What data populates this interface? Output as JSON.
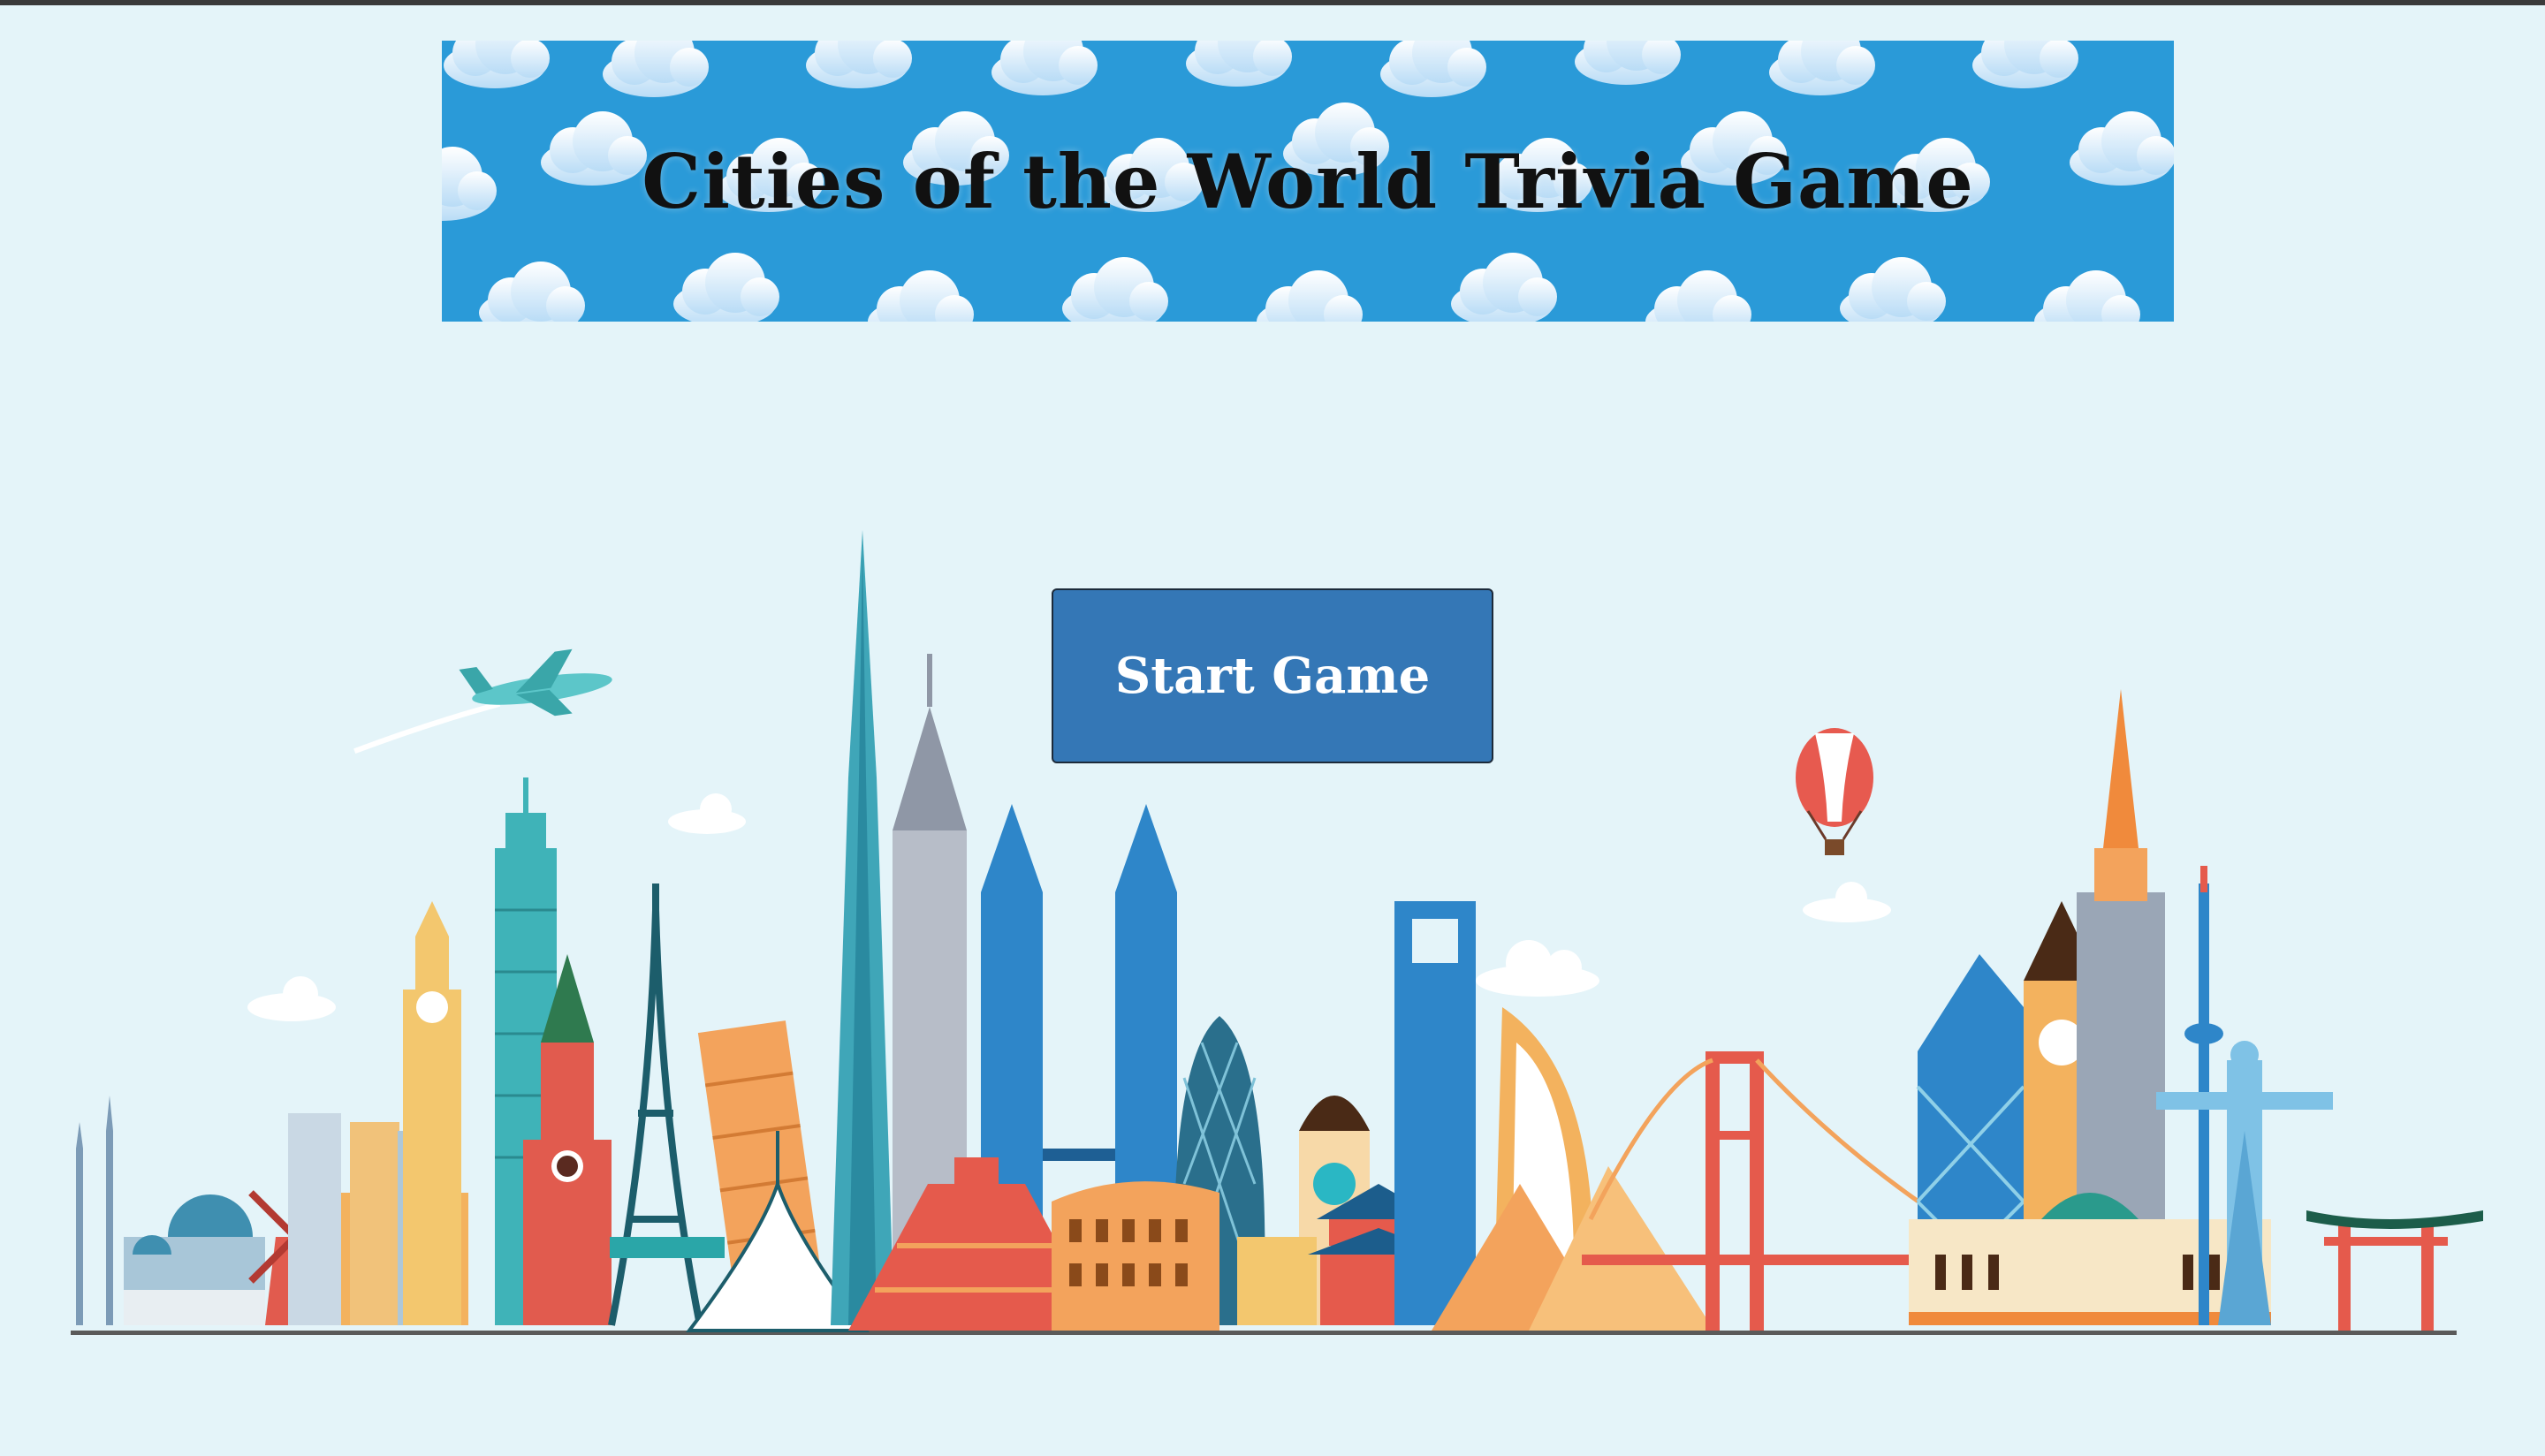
{
  "app": {
    "title": "Cities of the World Trivia Game"
  },
  "banner": {
    "title": "Cities of the World Trivia Game",
    "background_color": "#2a9ad8",
    "pattern": "clouds"
  },
  "actions": {
    "start_label": "Start Game",
    "start_color": "#3477b6"
  },
  "illustration": {
    "name": "world-landmarks-skyline",
    "icons": [
      "airplane-icon",
      "hot-air-balloon-icon"
    ]
  },
  "colors": {
    "page_background": "#e4f4f9"
  }
}
